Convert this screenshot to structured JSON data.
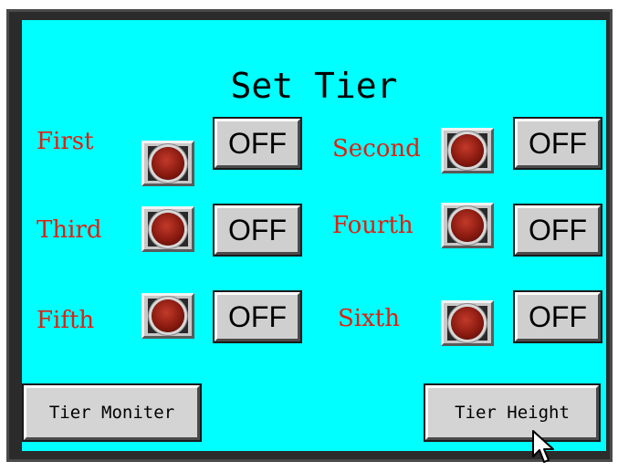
{
  "screen": {
    "title": "Set Tier",
    "background": "#00ffff",
    "label_color": "#e02010"
  },
  "tiers": [
    {
      "label": "First",
      "state": "OFF"
    },
    {
      "label": "Second",
      "state": "OFF"
    },
    {
      "label": "Third",
      "state": "OFF"
    },
    {
      "label": "Fourth",
      "state": "OFF"
    },
    {
      "label": "Fifth",
      "state": "OFF"
    },
    {
      "label": "Sixth",
      "state": "OFF"
    }
  ],
  "nav": {
    "monitor_label": "Tier Moniter",
    "height_label": "Tier Height"
  },
  "icons": {
    "lamp": "red-indicator-lamp-icon",
    "cursor": "mouse-pointer-icon"
  }
}
